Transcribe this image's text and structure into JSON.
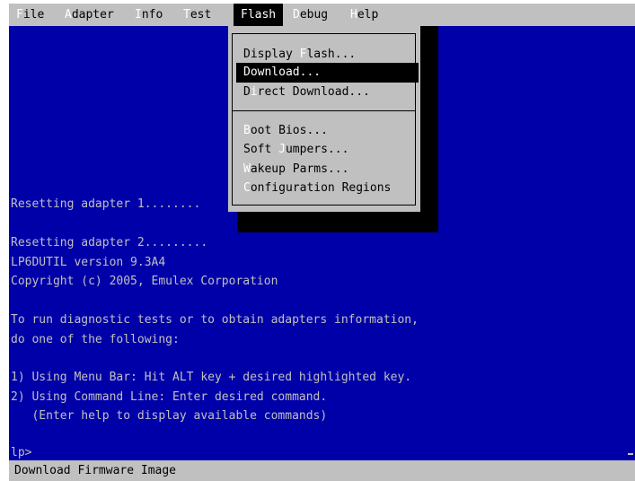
{
  "menubar": {
    "items": [
      {
        "hotkey": "F",
        "rest": "ile"
      },
      {
        "hotkey": "A",
        "rest": "dapter"
      },
      {
        "hotkey": "I",
        "rest": "nfo"
      },
      {
        "hotkey": "T",
        "rest": "est"
      },
      {
        "hotkey": "F",
        "rest": "lash"
      },
      {
        "hotkey": "D",
        "rest": "ebug"
      },
      {
        "hotkey": "H",
        "rest": "elp"
      }
    ],
    "active": "Flash"
  },
  "flash_menu": {
    "items": [
      {
        "pre": "Display ",
        "hotkey": "F",
        "post": "lash..."
      },
      {
        "pre": "Download...",
        "hotkey": "",
        "post": ""
      },
      {
        "pre": "D",
        "hotkey": "i",
        "post": "rect Download..."
      },
      {
        "pre": "",
        "hotkey": "B",
        "post": "oot Bios..."
      },
      {
        "pre": "Soft ",
        "hotkey": "J",
        "post": "umpers..."
      },
      {
        "pre": "",
        "hotkey": "W",
        "post": "akeup Parms..."
      },
      {
        "pre": "",
        "hotkey": "C",
        "post": "onfiguration Regions"
      }
    ],
    "selected": "Download..."
  },
  "console": {
    "lines": [
      "Resetting adapter 1........",
      "Resetting adapter 2.........",
      "LP6DUTIL version 9.3A4",
      "Copyright (c) 2005, Emulex Corporation",
      "To run diagnostic tests or to obtain adapters information,",
      "do one of the following:",
      "1) Using Menu Bar: Hit ALT key + desired highlighted key.",
      "2) Using Command Line: Enter desired command.",
      "   (Enter help to display available commands)",
      "lp>"
    ]
  },
  "statusbar": {
    "text": "Download Firmware Image"
  },
  "colors": {
    "console_bg": "#0000a8",
    "console_fg": "#c0c0c0",
    "menu_bg": "#c0c0c0",
    "highlight_bg": "#000000",
    "hotkey_fg": "#ffffff"
  }
}
